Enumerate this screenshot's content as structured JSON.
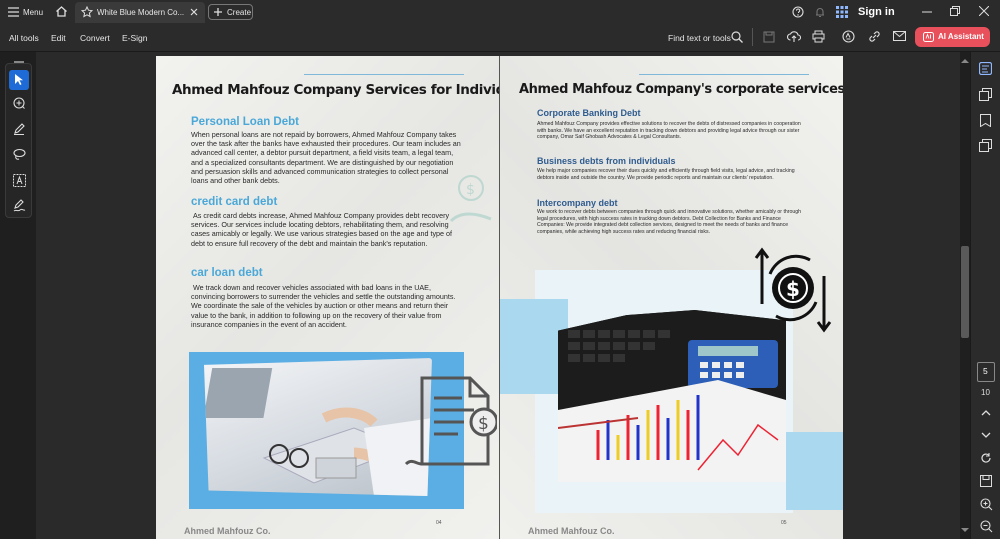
{
  "titlebar": {
    "menu_label": "Menu",
    "tab_title": "White Blue Modern Co...",
    "create_label": "Create",
    "sign_in_label": "Sign in"
  },
  "toolbar": {
    "all_tools": "All tools",
    "edit": "Edit",
    "convert": "Convert",
    "esign": "E-Sign",
    "find_text": "Find text or tools",
    "ai_assistant": "AI Assistant"
  },
  "page_nav": {
    "current_page": "5",
    "total_pages": "10"
  },
  "left_page": {
    "title": "Ahmed Mahfouz Company Services for Individuals",
    "sections": [
      {
        "heading": "Personal Loan Debt",
        "text": "When personal loans are not repaid by borrowers, Ahmed Mahfouz Company takes over the task after the banks have exhausted their procedures. Our team includes an advanced call center, a debtor pursuit department, a field visits team, a legal team, and a specialized consultants department. We are distinguished by our negotiation and persuasion skills and advanced communication strategies to collect personal loans and other bank debts."
      },
      {
        "heading": "credit card debt",
        "text": "As credit card debts increase, Ahmed Mahfouz Company provides debt recovery services. Our services include locating debtors, rehabilitating them, and resolving cases amicably or legally. We use various strategies based on the age and type of debt to ensure full recovery of the debt and maintain the bank's reputation."
      },
      {
        "heading": "car loan debt",
        "text": "We track down and recover vehicles associated with bad loans in the UAE, convincing borrowers to surrender the vehicles and settle the outstanding amounts. We coordinate the sale of the vehicles by auction or other means and return their value to the bank, in addition to following up on the recovery of their value from insurance companies in the event of an accident."
      }
    ],
    "footer_name": "Ahmed Mahfouz Co.",
    "page_number": "04"
  },
  "right_page": {
    "title": "Ahmed Mahfouz Company's corporate services",
    "sections": [
      {
        "heading": "Corporate Banking Debt",
        "text": "Ahmed Mahfouz Company provides effective solutions to recover the debts of distressed companies in cooperation with banks. We have an excellent reputation in tracking down debtors and providing legal advice through our sister company, Omar Saif Ghobash Advocates & Legal Consultants."
      },
      {
        "heading": "Business debts from individuals",
        "text": "We help major companies recover their dues quickly and efficiently through field visits, legal advice, and tracking debtors inside and outside the country. We provide periodic reports and maintain our clients' reputation."
      },
      {
        "heading": "Intercompany debt",
        "text": "We work to recover debts between companies through quick and innovative solutions, whether amicably or through legal procedures, with high success rates in tracking down debtors. Debt Collection for Banks and Finance Companies: We provide integrated debt collection services, designed to meet the needs of banks and finance companies, while achieving high success rates and reducing financial risks."
      }
    ],
    "footer_name": "Ahmed Mahfouz Co.",
    "page_number": "05"
  },
  "colors": {
    "accent_blue": "#4aa8d8",
    "dark_heading": "#2f5c8f",
    "ai_button": "#e8505b",
    "light_blue_block": "#a9d8ef"
  },
  "icons": [
    "menu-icon",
    "home-icon",
    "star-icon",
    "close-icon",
    "plus-icon",
    "help-icon",
    "bell-icon",
    "apps-icon",
    "minimize-icon",
    "restore-icon",
    "close-window-icon",
    "search-icon",
    "save-icon",
    "upload-icon",
    "print-icon",
    "stamp-icon",
    "link-icon",
    "mail-icon",
    "cursor-icon",
    "comment-icon",
    "pen-icon",
    "lasso-icon",
    "text-select-icon",
    "sign-icon",
    "panel-icon",
    "layers-icon",
    "bookmark-icon",
    "copy-icon",
    "chevron-up-icon",
    "chevron-down-icon",
    "refresh-icon",
    "save-page-icon",
    "zoom-in-icon",
    "zoom-out-icon",
    "invoice-icon",
    "dollar-cycle-icon"
  ]
}
